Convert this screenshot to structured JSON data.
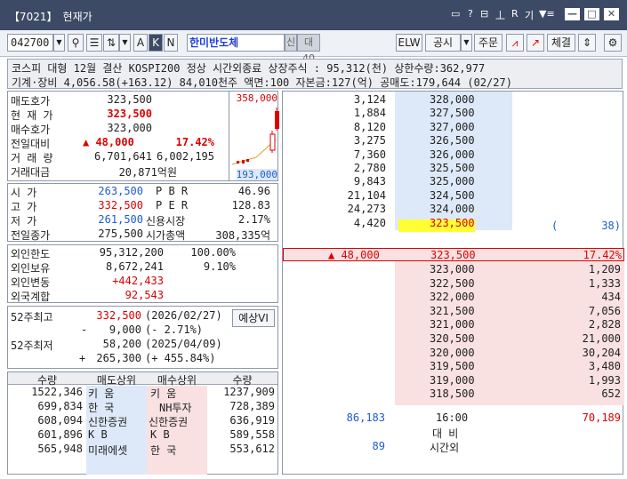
{
  "window": {
    "code_tag": "【7021】",
    "title": "현재가",
    "icons": [
      "▭",
      "?",
      "⊟",
      "丄",
      "R",
      "기",
      "▼≡"
    ]
  },
  "toolbar": {
    "code": "042700",
    "name": "한미반도체",
    "credit": "신",
    "margin": "대40",
    "elw": "ELW",
    "notice": "공시",
    "order": "주문",
    "fill": "체결"
  },
  "info": {
    "line1": "코스피 대형 12월 결산 KOSPI200 정상    시간외종료  상장주식 : 95,312(천) 상한수량:362,977",
    "line2": "기계·장비  4,056.58(+163.12) 84,010천주 액면:100 자본금:127(억) 공매도:179,644 (02/27)"
  },
  "quote": {
    "rows": [
      {
        "label": "매도호가",
        "value": "323,500"
      },
      {
        "label": "현 재 가",
        "value": "323,500"
      },
      {
        "label": "매수호가",
        "value": "323,000"
      },
      {
        "label": "전일대비",
        "value": "▲  48,000",
        "pct": "17.42%"
      },
      {
        "label": "거 래 량",
        "value": "6,701,641",
        "value2": "6,002,195"
      },
      {
        "label": "거래대금",
        "value": "20,871억원"
      }
    ],
    "chart_high": "358,000",
    "chart_low": "193,000"
  },
  "ohlc": [
    {
      "label": "시    가",
      "value": "263,500",
      "k": "P B R",
      "v": "46.96"
    },
    {
      "label": "고    가",
      "value": "332,500",
      "k": "P E R",
      "v": "128.83"
    },
    {
      "label": "저    가",
      "value": "261,500",
      "k": "신용시장",
      "v": "2.17%"
    },
    {
      "label": "전일종가",
      "value": "275,500",
      "k": "시가총액",
      "v": "308,335억"
    }
  ],
  "foreign": [
    {
      "label": "외인한도",
      "value": "95,312,200",
      "v2": "100.00%"
    },
    {
      "label": "외인보유",
      "value": "8,672,241",
      "v2": "9.10%"
    },
    {
      "label": "외인변동",
      "value": "+442,433"
    },
    {
      "label": "외국계합",
      "value": "92,543"
    }
  ],
  "week52": {
    "high_label": "52주최고",
    "high": "332,500",
    "high_date": "(2026/02/27)",
    "high_diff_sign": "-",
    "high_diff": "9,000",
    "high_pct": "(-   2.71%)",
    "low_label": "52주최저",
    "low": "58,200",
    "low_date": "(2025/04/09)",
    "low_diff_sign": "+",
    "low_diff": "265,300",
    "low_pct": "(+  455.84%)",
    "forecast": "예상VI"
  },
  "brokers": {
    "headers": [
      "수량",
      "매도상위",
      "매수상위",
      "수량"
    ],
    "rows": [
      [
        "1522,346",
        "키    움",
        "키    움",
        "1237,909"
      ],
      [
        "699,834",
        "한    국",
        "NH투자",
        "728,389"
      ],
      [
        "608,094",
        "신한증권",
        "신한증권",
        "636,919"
      ],
      [
        "601,896",
        "K      B",
        "K      B",
        "589,558"
      ],
      [
        "565,948",
        "미래에셋",
        "한    국",
        "553,612"
      ]
    ]
  },
  "orderbook": {
    "asks": [
      [
        "3,124",
        "328,000"
      ],
      [
        "1,884",
        "327,500"
      ],
      [
        "8,120",
        "327,000"
      ],
      [
        "3,275",
        "326,500"
      ],
      [
        "7,360",
        "326,000"
      ],
      [
        "2,780",
        "325,500"
      ],
      [
        "9,843",
        "325,000"
      ],
      [
        "21,104",
        "324,500"
      ],
      [
        "24,273",
        "324,000"
      ],
      [
        "4,420",
        "323,500"
      ]
    ],
    "ask_side_note_open": "(",
    "ask_side_note": "38)",
    "change": "▲  48,000",
    "current": "323,500",
    "change_pct": "17.42%",
    "bids": [
      [
        "323,000",
        "1,209"
      ],
      [
        "322,500",
        "1,333"
      ],
      [
        "322,000",
        "434"
      ],
      [
        "321,500",
        "7,056"
      ],
      [
        "321,000",
        "2,828"
      ],
      [
        "320,500",
        "21,000"
      ],
      [
        "320,000",
        "30,204"
      ],
      [
        "319,500",
        "3,480"
      ],
      [
        "319,000",
        "1,993"
      ],
      [
        "318,500",
        "652"
      ]
    ],
    "total_ask": "86,183",
    "time": "16:00",
    "total_bid": "70,189",
    "compare": "대  비",
    "after_qty": "89",
    "after_label": "시간외"
  }
}
